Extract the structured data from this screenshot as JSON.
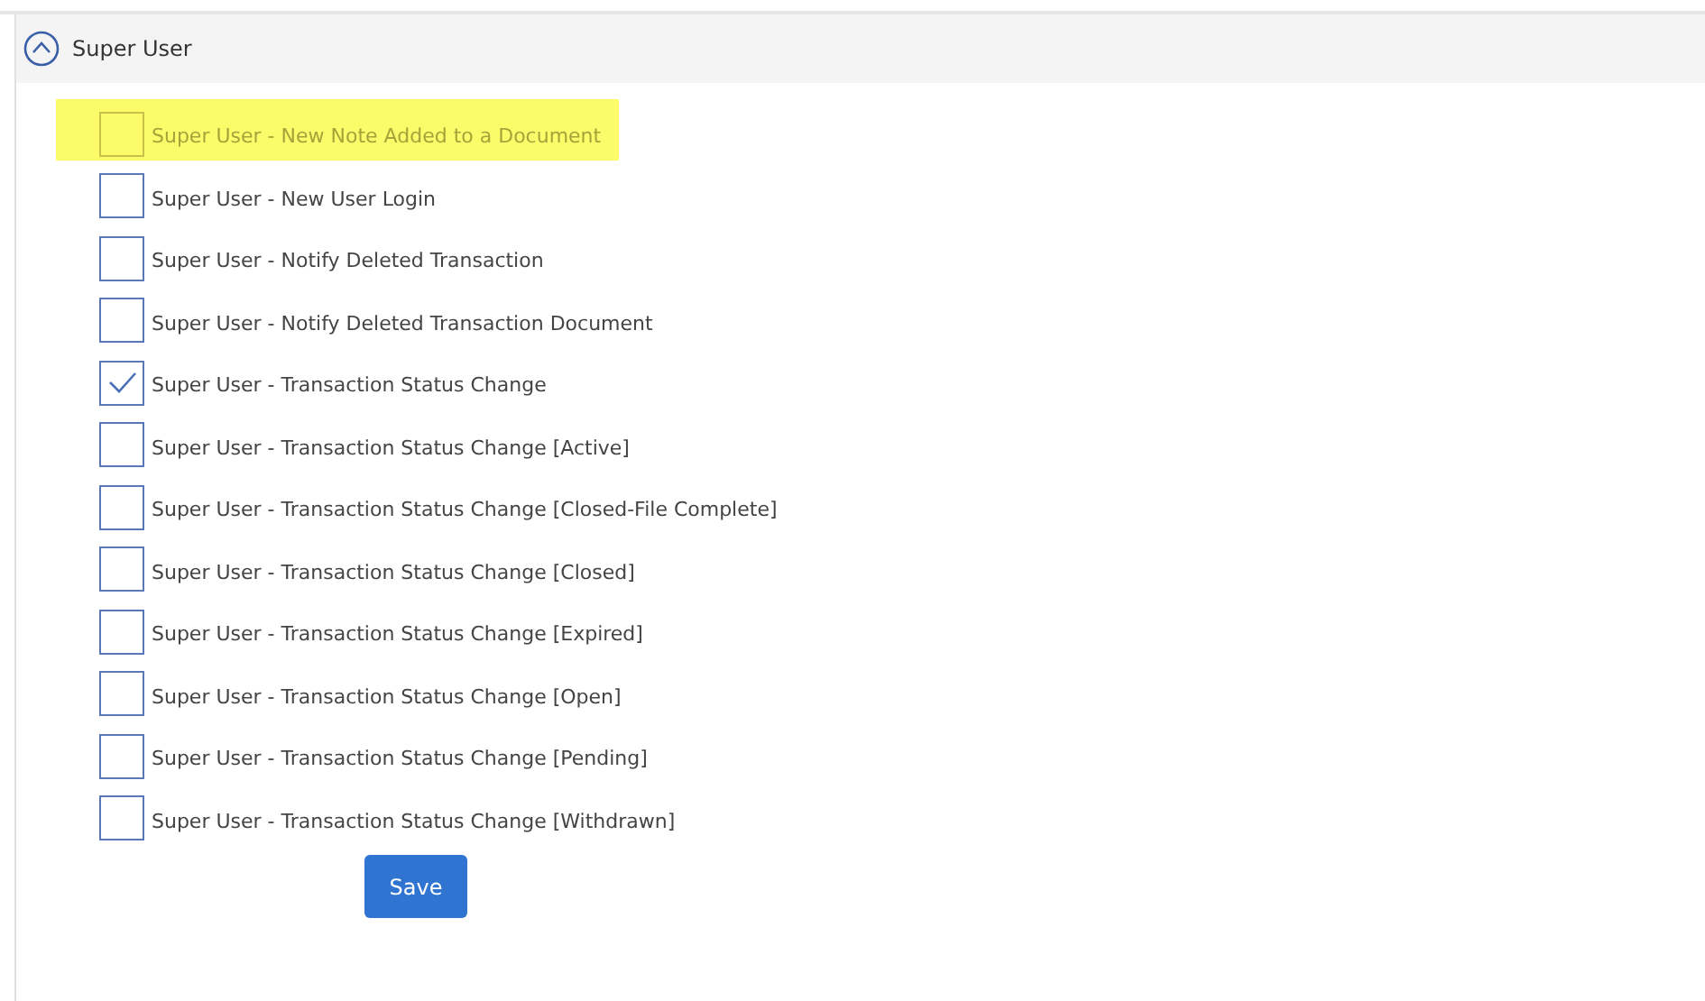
{
  "section": {
    "title": "Super User",
    "expanded": true
  },
  "items": [
    {
      "label": "Super User - New Note Added to a Document",
      "checked": false,
      "highlighted": true
    },
    {
      "label": "Super User - New User Login",
      "checked": false,
      "highlighted": false
    },
    {
      "label": "Super User - Notify Deleted Transaction",
      "checked": false,
      "highlighted": false
    },
    {
      "label": "Super User - Notify Deleted Transaction Document",
      "checked": false,
      "highlighted": false
    },
    {
      "label": "Super User - Transaction Status Change",
      "checked": true,
      "highlighted": false
    },
    {
      "label": "Super User - Transaction Status Change [Active]",
      "checked": false,
      "highlighted": false
    },
    {
      "label": "Super User - Transaction Status Change [Closed-File Complete]",
      "checked": false,
      "highlighted": false
    },
    {
      "label": "Super User - Transaction Status Change [Closed]",
      "checked": false,
      "highlighted": false
    },
    {
      "label": "Super User - Transaction Status Change [Expired]",
      "checked": false,
      "highlighted": false
    },
    {
      "label": "Super User - Transaction Status Change [Open]",
      "checked": false,
      "highlighted": false
    },
    {
      "label": "Super User - Transaction Status Change [Pending]",
      "checked": false,
      "highlighted": false
    },
    {
      "label": "Super User - Transaction Status Change [Withdrawn]",
      "checked": false,
      "highlighted": false
    }
  ],
  "save_button": "Save"
}
